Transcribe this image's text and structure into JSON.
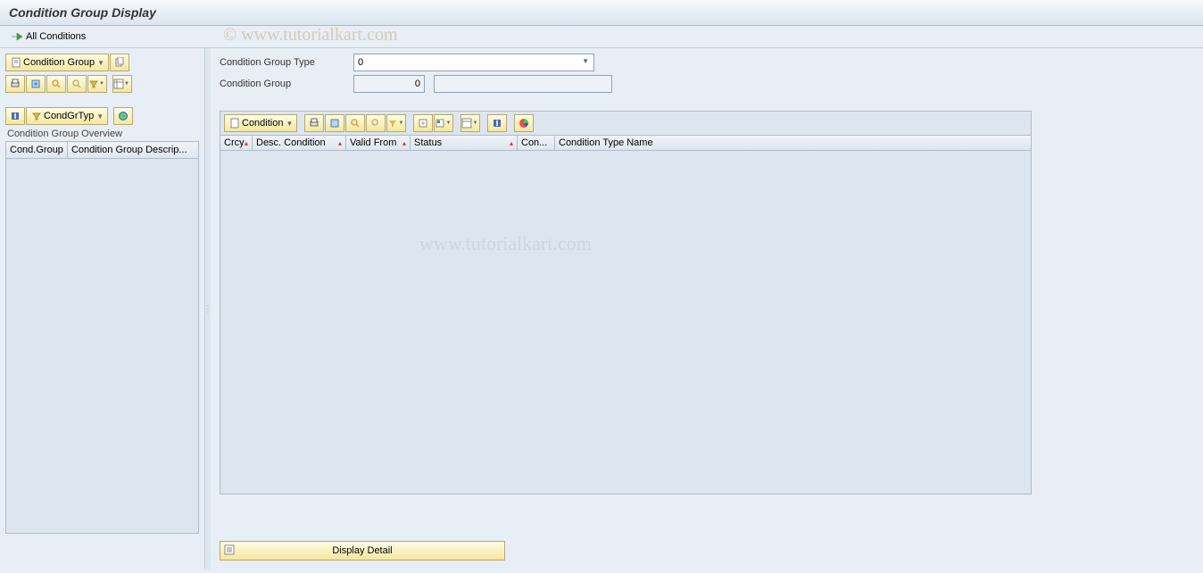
{
  "title": "Condition Group Display",
  "main_toolbar": {
    "all_conditions": "All Conditions"
  },
  "left": {
    "condition_group_btn": "Condition Group",
    "condgrtyp_btn": "CondGrTyp",
    "overview_label": "Condition Group Overview",
    "col_group": "Cond.Group",
    "col_desc": "Condition Group Descrip..."
  },
  "form": {
    "type_label": "Condition Group Type",
    "type_value": "0",
    "group_label": "Condition Group",
    "group_value": "0",
    "group_desc": ""
  },
  "grid": {
    "condition_btn": "Condition",
    "cols": {
      "crcy": "Crcy",
      "desc": "Desc. Condition",
      "valid_from": "Valid From",
      "status": "Status",
      "con": "Con...",
      "type_name": "Condition Type Name"
    }
  },
  "detail_btn": "Display Detail",
  "watermark1": "© www.tutorialkart.com",
  "watermark2": "www.tutorialkart.com"
}
